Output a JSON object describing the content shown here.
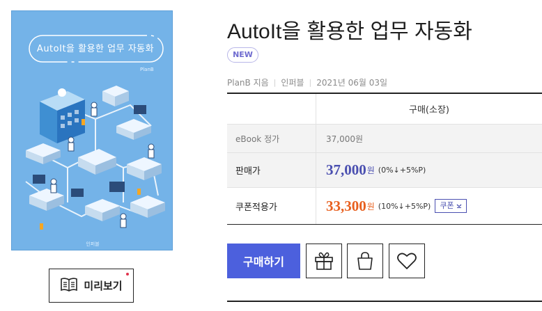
{
  "cover": {
    "title": "AutoIt을 활용한 업무 자동화",
    "author": "PlanB",
    "publisher": "인퍼블"
  },
  "preview": {
    "label": "미리보기"
  },
  "book": {
    "title": "AutoIt을 활용한 업무 자동화",
    "badge": "NEW",
    "author": "PlanB 지음",
    "publisher": "인퍼블",
    "date": "2021년 06월 03일"
  },
  "price_table": {
    "header": "구매(소장)",
    "ebook_label": "eBook 정가",
    "ebook_price": "37,000원",
    "sale_label": "판매가",
    "sale_price": "37,000",
    "sale_unit": "원",
    "sale_detail": "(0%↓+5%P)",
    "coupon_label": "쿠폰적용가",
    "coupon_price": "33,300",
    "coupon_unit": "원",
    "coupon_detail": "(10%↓+5%P)",
    "coupon_button": "쿠폰"
  },
  "actions": {
    "buy_label": "구매하기",
    "icons": [
      "gift-icon",
      "shopping-bag-icon",
      "heart-icon"
    ]
  },
  "colors": {
    "accent_blue": "#4c60dd",
    "price_blue": "#4a4fb0",
    "price_orange": "#e8601f",
    "cover_bg": "#74b3e8"
  }
}
